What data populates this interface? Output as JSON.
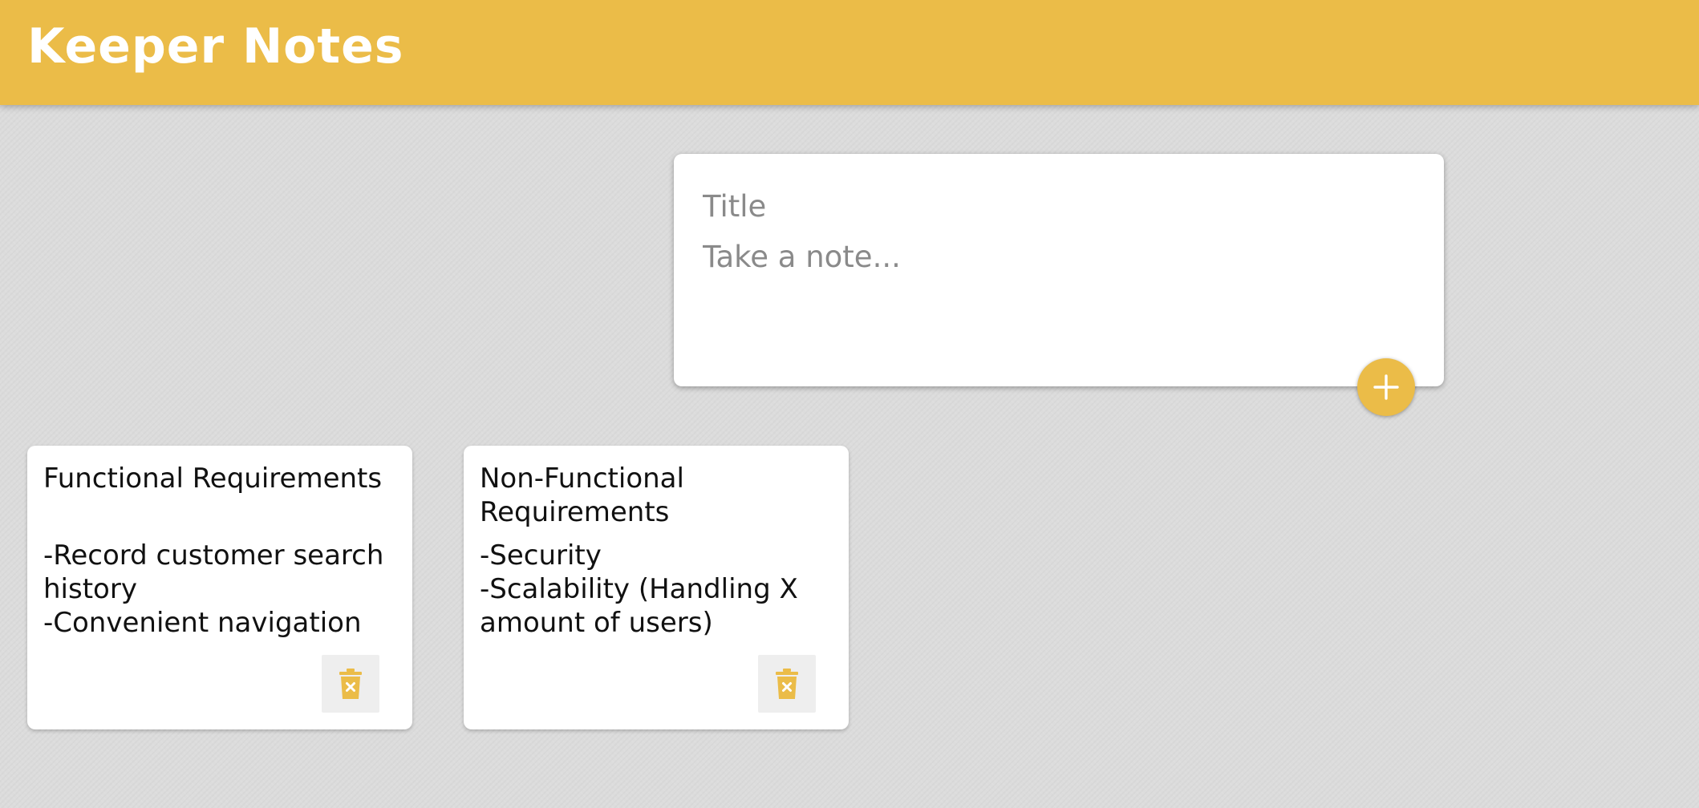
{
  "header": {
    "title": "Keeper Notes"
  },
  "create_note": {
    "title_placeholder": "Title",
    "content_placeholder": "Take a note...",
    "add_icon": "plus-icon"
  },
  "notes": [
    {
      "title": "Functional Requirements",
      "content": "-Record customer search history\n-Convenient navigation",
      "delete_icon": "trash-icon"
    },
    {
      "title": "Non-Functional Requirements",
      "content": "-Security\n-Scalability (Handling X amount of users)",
      "delete_icon": "trash-icon"
    }
  ],
  "colors": {
    "accent": "#ebbc48",
    "background": "#dcdcdc",
    "card": "#ffffff",
    "delete_button_bg": "#eeeeee"
  }
}
